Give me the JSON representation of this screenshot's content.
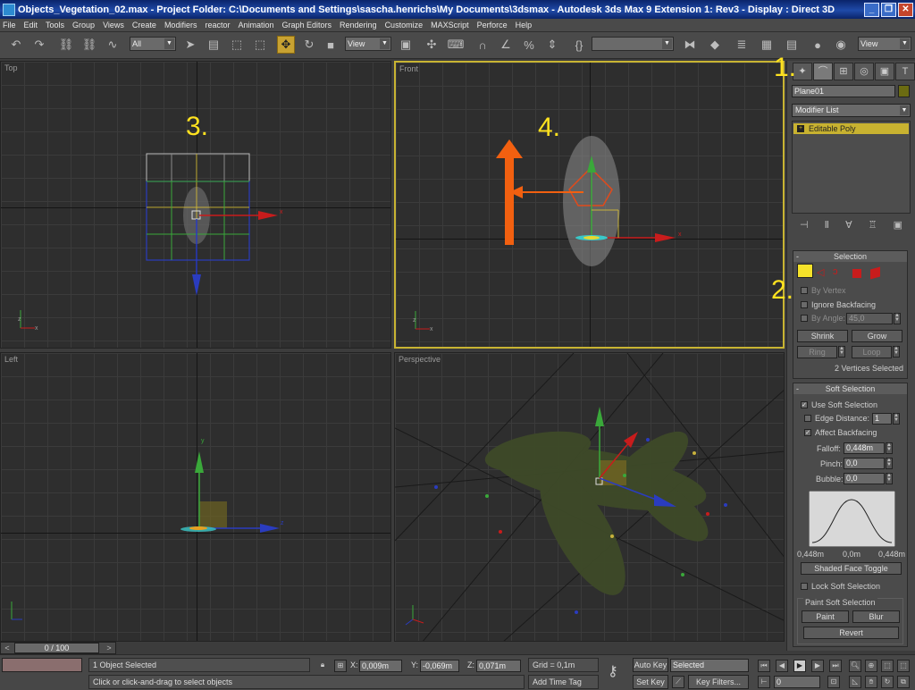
{
  "window": {
    "title": "Objects_Vegetation_02.max    - Project Folder: C:\\Documents and Settings\\sascha.henrichs\\My Documents\\3dsmax    - Autodesk 3ds Max 9 Extension 1: Rev3    - Display : Direct 3D",
    "controls": [
      "_",
      "❐",
      "✕"
    ]
  },
  "menu": [
    "File",
    "Edit",
    "Tools",
    "Group",
    "Views",
    "Create",
    "Modifiers",
    "reactor",
    "Animation",
    "Graph Editors",
    "Rendering",
    "Customize",
    "MAXScript",
    "Perforce",
    "Help"
  ],
  "toolbar": {
    "selection_filter": "All",
    "ref_coord_1": "View",
    "named_selection": "",
    "ref_coord_2": "View"
  },
  "viewports": {
    "top": {
      "label": "Top",
      "step": "3."
    },
    "front": {
      "label": "Front",
      "step": "4."
    },
    "left": {
      "label": "Left"
    },
    "perspective": {
      "label": "Perspective"
    }
  },
  "annotations": {
    "step1": "1.",
    "step2": "2."
  },
  "command_panel": {
    "object_name": "Plane01",
    "modifier_list": "Modifier List",
    "stack_item": "Editable Poly",
    "stack_icon": "+",
    "selection": {
      "title": "Selection",
      "by_vertex": "By Vertex",
      "ignore_backfacing": "Ignore Backfacing",
      "by_angle": "By Angle:",
      "by_angle_value": "45,0",
      "shrink": "Shrink",
      "grow": "Grow",
      "ring": "Ring",
      "loop": "Loop",
      "status": "2 Vertices Selected"
    },
    "soft_selection": {
      "title": "Soft Selection",
      "use_soft": "Use Soft Selection",
      "edge_distance": "Edge Distance:",
      "edge_distance_value": "1",
      "affect_backfacing": "Affect Backfacing",
      "falloff_label": "Falloff:",
      "falloff_value": "0,448m",
      "pinch_label": "Pinch:",
      "pinch_value": "0,0",
      "bubble_label": "Bubble:",
      "bubble_value": "0,0",
      "curve_left": "0,448m",
      "curve_mid": "0,0m",
      "curve_right": "0,448m",
      "shaded_face_toggle": "Shaded Face Toggle",
      "lock_soft": "Lock Soft Selection",
      "paint_group": "Paint Soft Selection",
      "paint": "Paint",
      "blur": "Blur",
      "revert": "Revert"
    }
  },
  "timeline": {
    "frame": "0 / 100",
    "prev": "<",
    "next": ">"
  },
  "statusbar": {
    "selected": "1 Object Selected",
    "prompt": "Click or click-and-drag to select objects",
    "x_label": "X:",
    "x": "0,009m",
    "y_label": "Y:",
    "y": "-0,069m",
    "z_label": "Z:",
    "z": "0,071m",
    "grid": "Grid = 0,1m",
    "add_time_tag": "Add Time Tag",
    "auto_key": "Auto Key",
    "set_key": "Set Key",
    "key_mode": "Selected",
    "key_filters": "Key Filters...",
    "current_frame": "0"
  }
}
